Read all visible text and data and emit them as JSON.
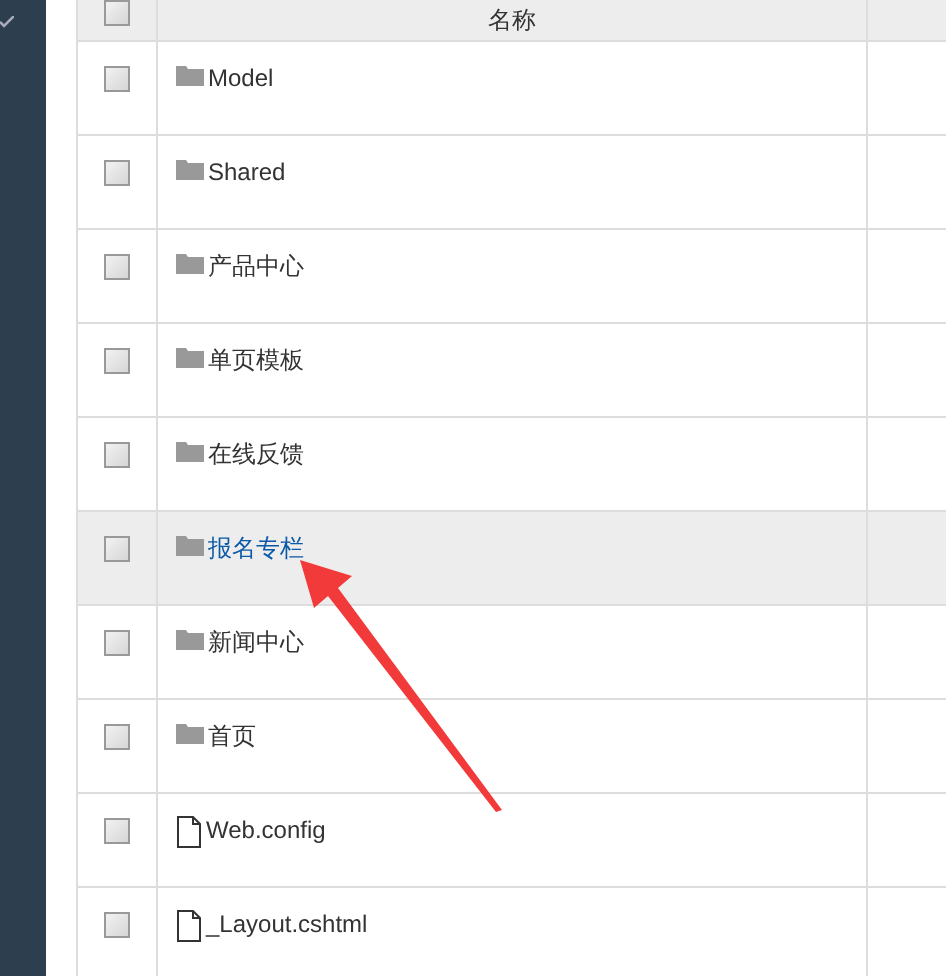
{
  "table": {
    "select_all": {
      "checked": false
    },
    "columns": [
      "名称"
    ],
    "rows": [
      {
        "name": "Model",
        "kind": "folder",
        "selected": false,
        "checked": false
      },
      {
        "name": "Shared",
        "kind": "folder",
        "selected": false,
        "checked": false
      },
      {
        "name": "产品中心",
        "kind": "folder",
        "selected": false,
        "checked": false
      },
      {
        "name": "单页模板",
        "kind": "folder",
        "selected": false,
        "checked": false
      },
      {
        "name": "在线反馈",
        "kind": "folder",
        "selected": false,
        "checked": false
      },
      {
        "name": "报名专栏",
        "kind": "folder",
        "selected": true,
        "checked": false
      },
      {
        "name": "新闻中心",
        "kind": "folder",
        "selected": false,
        "checked": false
      },
      {
        "name": "首页",
        "kind": "folder",
        "selected": false,
        "checked": false
      },
      {
        "name": "Web.config",
        "kind": "file",
        "selected": false,
        "checked": false
      },
      {
        "name": "_Layout.cshtml",
        "kind": "file",
        "selected": false,
        "checked": false
      }
    ]
  }
}
